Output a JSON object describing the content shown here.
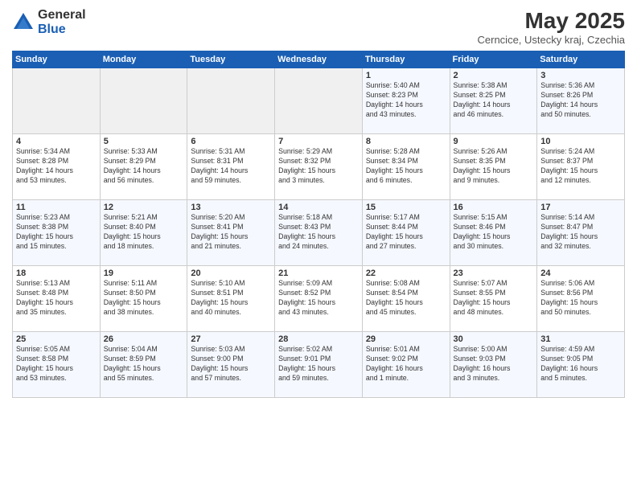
{
  "logo": {
    "general": "General",
    "blue": "Blue"
  },
  "title": "May 2025",
  "location": "Cerncice, Ustecky kraj, Czechia",
  "days_header": [
    "Sunday",
    "Monday",
    "Tuesday",
    "Wednesday",
    "Thursday",
    "Friday",
    "Saturday"
  ],
  "weeks": [
    [
      {
        "day": "",
        "info": ""
      },
      {
        "day": "",
        "info": ""
      },
      {
        "day": "",
        "info": ""
      },
      {
        "day": "",
        "info": ""
      },
      {
        "day": "1",
        "info": "Sunrise: 5:40 AM\nSunset: 8:23 PM\nDaylight: 14 hours\nand 43 minutes."
      },
      {
        "day": "2",
        "info": "Sunrise: 5:38 AM\nSunset: 8:25 PM\nDaylight: 14 hours\nand 46 minutes."
      },
      {
        "day": "3",
        "info": "Sunrise: 5:36 AM\nSunset: 8:26 PM\nDaylight: 14 hours\nand 50 minutes."
      }
    ],
    [
      {
        "day": "4",
        "info": "Sunrise: 5:34 AM\nSunset: 8:28 PM\nDaylight: 14 hours\nand 53 minutes."
      },
      {
        "day": "5",
        "info": "Sunrise: 5:33 AM\nSunset: 8:29 PM\nDaylight: 14 hours\nand 56 minutes."
      },
      {
        "day": "6",
        "info": "Sunrise: 5:31 AM\nSunset: 8:31 PM\nDaylight: 14 hours\nand 59 minutes."
      },
      {
        "day": "7",
        "info": "Sunrise: 5:29 AM\nSunset: 8:32 PM\nDaylight: 15 hours\nand 3 minutes."
      },
      {
        "day": "8",
        "info": "Sunrise: 5:28 AM\nSunset: 8:34 PM\nDaylight: 15 hours\nand 6 minutes."
      },
      {
        "day": "9",
        "info": "Sunrise: 5:26 AM\nSunset: 8:35 PM\nDaylight: 15 hours\nand 9 minutes."
      },
      {
        "day": "10",
        "info": "Sunrise: 5:24 AM\nSunset: 8:37 PM\nDaylight: 15 hours\nand 12 minutes."
      }
    ],
    [
      {
        "day": "11",
        "info": "Sunrise: 5:23 AM\nSunset: 8:38 PM\nDaylight: 15 hours\nand 15 minutes."
      },
      {
        "day": "12",
        "info": "Sunrise: 5:21 AM\nSunset: 8:40 PM\nDaylight: 15 hours\nand 18 minutes."
      },
      {
        "day": "13",
        "info": "Sunrise: 5:20 AM\nSunset: 8:41 PM\nDaylight: 15 hours\nand 21 minutes."
      },
      {
        "day": "14",
        "info": "Sunrise: 5:18 AM\nSunset: 8:43 PM\nDaylight: 15 hours\nand 24 minutes."
      },
      {
        "day": "15",
        "info": "Sunrise: 5:17 AM\nSunset: 8:44 PM\nDaylight: 15 hours\nand 27 minutes."
      },
      {
        "day": "16",
        "info": "Sunrise: 5:15 AM\nSunset: 8:46 PM\nDaylight: 15 hours\nand 30 minutes."
      },
      {
        "day": "17",
        "info": "Sunrise: 5:14 AM\nSunset: 8:47 PM\nDaylight: 15 hours\nand 32 minutes."
      }
    ],
    [
      {
        "day": "18",
        "info": "Sunrise: 5:13 AM\nSunset: 8:48 PM\nDaylight: 15 hours\nand 35 minutes."
      },
      {
        "day": "19",
        "info": "Sunrise: 5:11 AM\nSunset: 8:50 PM\nDaylight: 15 hours\nand 38 minutes."
      },
      {
        "day": "20",
        "info": "Sunrise: 5:10 AM\nSunset: 8:51 PM\nDaylight: 15 hours\nand 40 minutes."
      },
      {
        "day": "21",
        "info": "Sunrise: 5:09 AM\nSunset: 8:52 PM\nDaylight: 15 hours\nand 43 minutes."
      },
      {
        "day": "22",
        "info": "Sunrise: 5:08 AM\nSunset: 8:54 PM\nDaylight: 15 hours\nand 45 minutes."
      },
      {
        "day": "23",
        "info": "Sunrise: 5:07 AM\nSunset: 8:55 PM\nDaylight: 15 hours\nand 48 minutes."
      },
      {
        "day": "24",
        "info": "Sunrise: 5:06 AM\nSunset: 8:56 PM\nDaylight: 15 hours\nand 50 minutes."
      }
    ],
    [
      {
        "day": "25",
        "info": "Sunrise: 5:05 AM\nSunset: 8:58 PM\nDaylight: 15 hours\nand 53 minutes."
      },
      {
        "day": "26",
        "info": "Sunrise: 5:04 AM\nSunset: 8:59 PM\nDaylight: 15 hours\nand 55 minutes."
      },
      {
        "day": "27",
        "info": "Sunrise: 5:03 AM\nSunset: 9:00 PM\nDaylight: 15 hours\nand 57 minutes."
      },
      {
        "day": "28",
        "info": "Sunrise: 5:02 AM\nSunset: 9:01 PM\nDaylight: 15 hours\nand 59 minutes."
      },
      {
        "day": "29",
        "info": "Sunrise: 5:01 AM\nSunset: 9:02 PM\nDaylight: 16 hours\nand 1 minute."
      },
      {
        "day": "30",
        "info": "Sunrise: 5:00 AM\nSunset: 9:03 PM\nDaylight: 16 hours\nand 3 minutes."
      },
      {
        "day": "31",
        "info": "Sunrise: 4:59 AM\nSunset: 9:05 PM\nDaylight: 16 hours\nand 5 minutes."
      }
    ]
  ]
}
